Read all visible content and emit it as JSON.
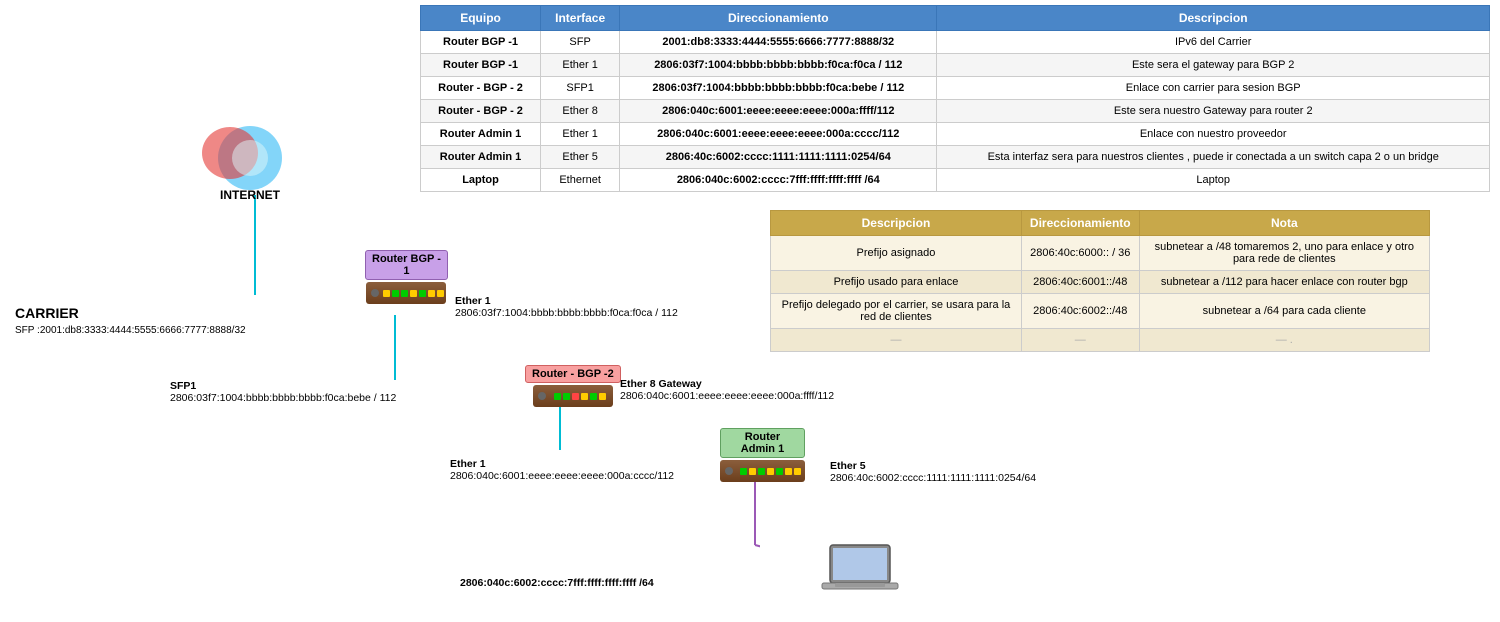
{
  "table": {
    "headers": [
      "Equipo",
      "Interface",
      "Direccionamiento",
      "Descripcion"
    ],
    "rows": [
      {
        "equipo": "Router BGP -1",
        "interface": "SFP",
        "dir": "2001:db8:3333:4444:5555:6666:7777:8888/32",
        "desc": "IPv6 del Carrier"
      },
      {
        "equipo": "Router BGP -1",
        "interface": "Ether 1",
        "dir": "2806:03f7:1004:bbbb:bbbb:bbbb:f0ca:f0ca / 112",
        "desc": "Este sera el gateway para BGP 2"
      },
      {
        "equipo": "Router - BGP - 2",
        "interface": "SFP1",
        "dir": "2806:03f7:1004:bbbb:bbbb:bbbb:f0ca:bebe / 112",
        "desc": "Enlace con carrier para sesion BGP"
      },
      {
        "equipo": "Router - BGP - 2",
        "interface": "Ether 8",
        "dir": "2806:040c:6001:eeee:eeee:eeee:000a:ffff/112",
        "desc": "Este sera nuestro Gateway para router 2"
      },
      {
        "equipo": "Router Admin 1",
        "interface": "Ether 1",
        "dir": "2806:040c:6001:eeee:eeee:eeee:000a:cccc/112",
        "desc": "Enlace con nuestro proveedor"
      },
      {
        "equipo": "Router Admin 1",
        "interface": "Ether 5",
        "dir": "2806:40c:6002:cccc:1111:1111:1111:0254/64",
        "desc": "Esta interfaz sera para nuestros clientes , puede ir conectada a un switch capa 2 o un bridge"
      },
      {
        "equipo": "Laptop",
        "interface": "Ethernet",
        "dir": "2806:040c:6002:cccc:7fff:ffff:ffff:ffff /64",
        "desc": "Laptop"
      }
    ]
  },
  "secondary_table": {
    "headers": [
      "Descripcion",
      "Direccionamiento",
      "Nota"
    ],
    "rows": [
      {
        "desc": "Prefijo asignado",
        "dir": "2806:40c:6000:: / 36",
        "nota": "subnetear a /48  tomaremos 2, uno para enlace y otro para rede de clientes"
      },
      {
        "desc": "Prefijo usado para enlace",
        "dir": "2806:40c:6001::/48",
        "nota": "subnetear a /112 para hacer enlace con router bgp"
      },
      {
        "desc": "Prefijo delegado por el carrier, se usara para la red de clientes",
        "dir": "2806:40c:6002::/48",
        "nota": "subnetear a /64 para cada cliente"
      },
      {
        "desc": "—",
        "dir": "—",
        "nota": "— ."
      }
    ]
  },
  "diagram": {
    "internet_label": "INTERNET",
    "carrier_label": "CARRIER",
    "carrier_sfp": "SFP :2001:db8:3333:4444:5555:6666:7777:8888/32",
    "router_bgp1_label": "Router BGP -\n1",
    "router_bgp1_ether1_title": "Ether 1",
    "router_bgp1_ether1_addr": "2806:03f7:1004:bbbb:bbbb:bbbb:f0ca:f0ca / 112",
    "router_bgp2_label": "Router - BGP -2",
    "router_bgp2_sfp1_title": "SFP1",
    "router_bgp2_sfp1_addr": "2806:03f7:1004:bbbb:bbbb:bbbb:f0ca:bebe / 112",
    "router_bgp2_ether8_title": "Ether 8 Gateway",
    "router_bgp2_ether8_addr": "2806:040c:6001:eeee:eeee:eeee:000a:ffff/112",
    "router_admin1_label": "Router Admin 1",
    "router_admin1_ether1_title": "Ether 1",
    "router_admin1_ether1_addr": "2806:040c:6001:eeee:eeee:eeee:000a:cccc/112",
    "router_admin1_ether5_title": "Ether 5",
    "router_admin1_ether5_addr": "2806:40c:6002:cccc:1111:1111:1111:0254/64",
    "laptop_addr": "2806:040c:6002:cccc:7fff:ffff:ffff:ffff /64"
  }
}
